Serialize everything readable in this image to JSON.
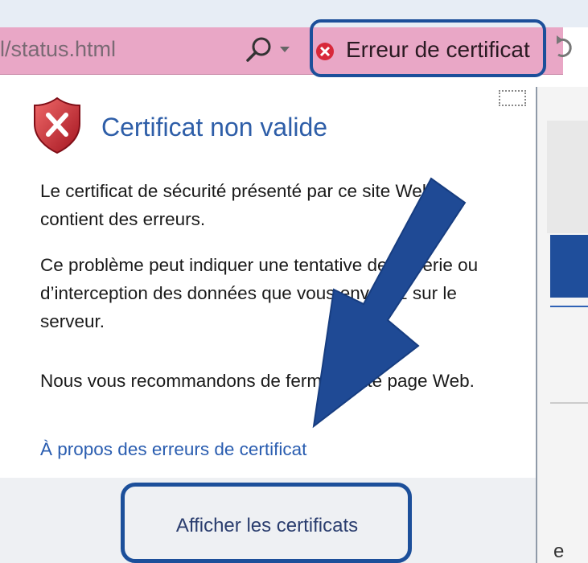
{
  "address_bar": {
    "url_fragment": "l/status.html",
    "cert_error_label": "Erreur de certificat"
  },
  "popup": {
    "title": "Certificat non valide",
    "paragraphs": [
      "Le certificat de sécurité présenté par ce site Web contient des erreurs.",
      "Ce problème peut indiquer une tentative de duperie ou d’interception des données que vous envoyez sur le serveur.",
      "Nous vous recommandons de fermer cette page Web."
    ],
    "about_link": "À propos des erreurs de certificat",
    "show_certificates_button": "Afficher les certificats"
  },
  "page_edge_char": "e",
  "colors": {
    "highlight_outline": "#1c4f9a",
    "address_bar_error": "#e9a7c6",
    "title_blue": "#2e5ea8",
    "link_blue": "#2a5db0"
  },
  "icons": [
    "search-icon",
    "chevron-down-icon",
    "error-icon",
    "shield-error-icon",
    "refresh-icon"
  ]
}
